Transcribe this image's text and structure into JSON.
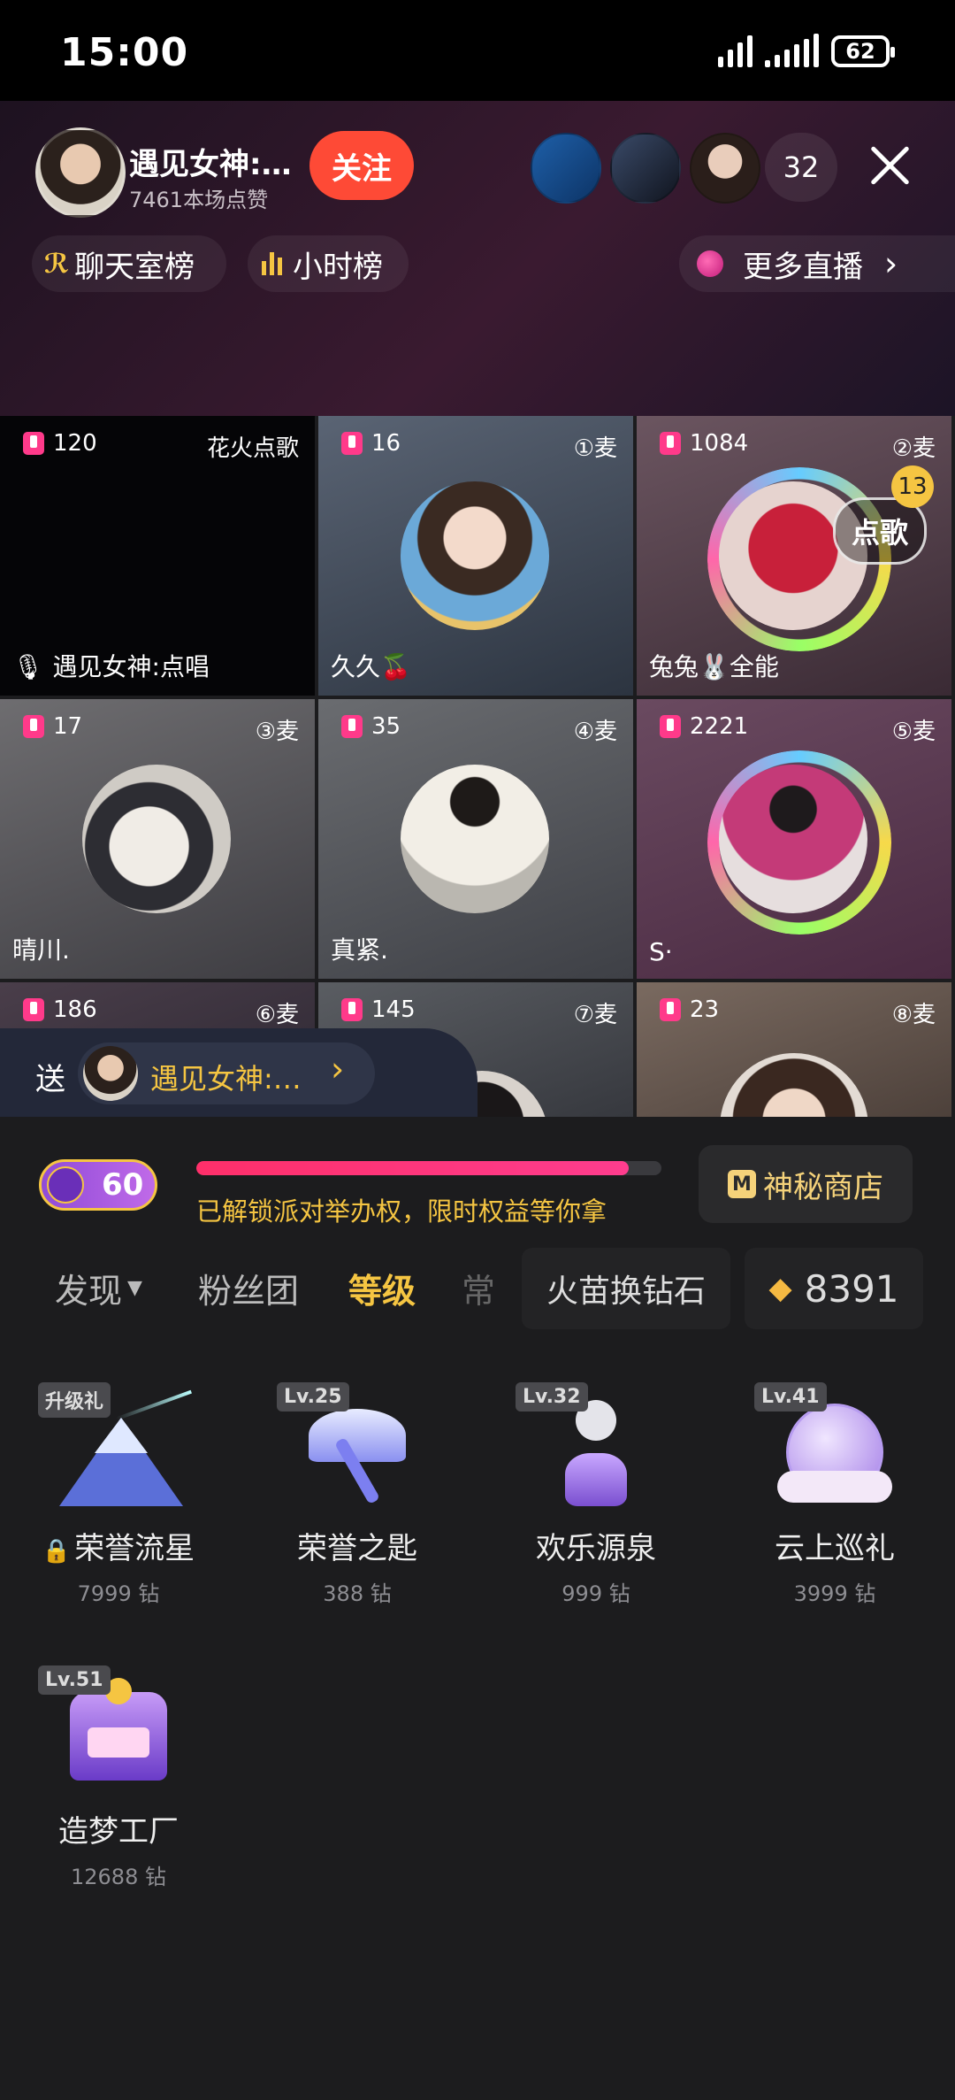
{
  "status_bar": {
    "time": "15:00",
    "battery": "62"
  },
  "header": {
    "host_name": "遇见女神:…",
    "host_likes": "7461本场点赞",
    "follow_label": "关注",
    "viewer_count": "32",
    "chat_rank_label": "聊天室榜",
    "hour_rank_label": "小时榜",
    "more_live_label": "更多直播"
  },
  "seats": [
    {
      "count": "120",
      "tag": "花火点歌",
      "name": "遇见女神:点唱"
    },
    {
      "count": "16",
      "tag": "①麦",
      "name": "久久🍒"
    },
    {
      "count": "1084",
      "tag": "②麦",
      "name": "兔兔🐰全能",
      "song_badge": "点歌",
      "song_count": "13"
    },
    {
      "count": "17",
      "tag": "③麦",
      "name": "晴川."
    },
    {
      "count": "35",
      "tag": "④麦",
      "name": "真紧."
    },
    {
      "count": "2221",
      "tag": "⑤麦",
      "name": "S·"
    },
    {
      "count": "186",
      "tag": "⑥麦",
      "name": ""
    },
    {
      "count": "145",
      "tag": "⑦麦",
      "name": ""
    },
    {
      "count": "23",
      "tag": "⑧麦",
      "name": ""
    }
  ],
  "send_bar": {
    "send_label": "送",
    "recipient": "遇见女神:…"
  },
  "level_panel": {
    "level": "60",
    "progress": 0.93,
    "hint": "已解锁派对举办权，限时权益等你拿",
    "shop_label": "神秘商店"
  },
  "tabs": [
    "发现",
    "粉丝团",
    "等级",
    "常"
  ],
  "active_tab": "等级",
  "exchange_label": "火苗换钻石",
  "diamond_balance": "8391",
  "gifts": [
    {
      "tag": "升级礼",
      "name": "荣誉流星",
      "price": "7999 钻",
      "locked": true
    },
    {
      "tag": "Lv.25",
      "name": "荣誉之匙",
      "price": "388 钻"
    },
    {
      "tag": "Lv.32",
      "name": "欢乐源泉",
      "price": "999 钻"
    },
    {
      "tag": "Lv.41",
      "name": "云上巡礼",
      "price": "3999 钻"
    },
    {
      "tag": "Lv.51",
      "name": "造梦工厂",
      "price": "12688 钻"
    }
  ],
  "colors": {
    "accent_red": "#fe4a36",
    "gold": "#f5c542",
    "panel_bg": "#1c1c1e"
  }
}
